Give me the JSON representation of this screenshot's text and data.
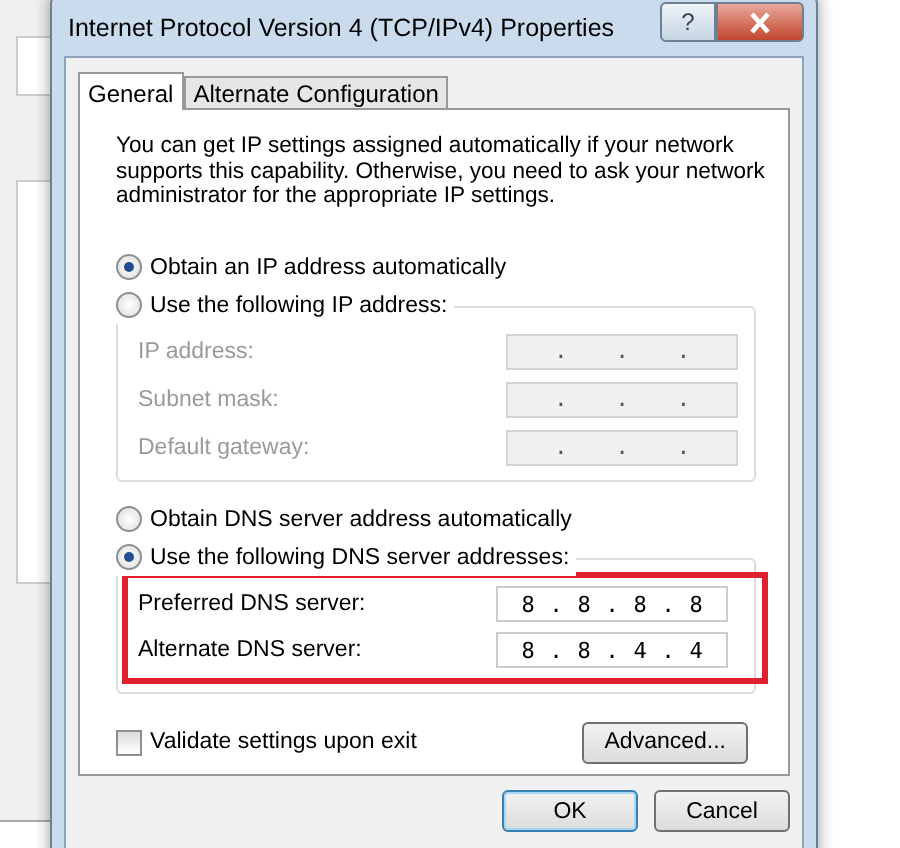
{
  "window": {
    "title": "Internet Protocol Version 4 (TCP/IPv4) Properties",
    "help": "?"
  },
  "tabs": [
    {
      "label": "General",
      "selected": true
    },
    {
      "label": "Alternate Configuration",
      "selected": false
    }
  ],
  "description": "You can get IP settings assigned automatically if your network supports this capability. Otherwise, you need to ask your network administrator for the appropriate IP settings.",
  "ip_options": [
    {
      "label": "Obtain an IP address automatically",
      "selected": true
    },
    {
      "label": "Use the following IP address:",
      "selected": false
    }
  ],
  "ip_fields": [
    {
      "label": "IP address:",
      "parts": [
        ".",
        ".",
        "."
      ],
      "disabled": true
    },
    {
      "label": "Subnet mask:",
      "parts": [
        ".",
        ".",
        "."
      ],
      "disabled": true
    },
    {
      "label": "Default gateway:",
      "parts": [
        ".",
        ".",
        "."
      ],
      "disabled": true
    }
  ],
  "dns_options": [
    {
      "label": "Obtain DNS server address automatically",
      "selected": false
    },
    {
      "label": "Use the following DNS server addresses:",
      "selected": true
    }
  ],
  "dns_fields": [
    {
      "label": "Preferred DNS server:",
      "parts": [
        "8",
        ".",
        "8",
        ".",
        "8",
        ".",
        "8"
      ],
      "disabled": false
    },
    {
      "label": "Alternate DNS server:",
      "parts": [
        "8",
        ".",
        "8",
        ".",
        "4",
        ".",
        "4"
      ],
      "disabled": false
    }
  ],
  "validate": {
    "label": "Validate settings upon exit",
    "checked": false
  },
  "advanced_button": "Advanced...",
  "buttons": [
    {
      "label": "OK",
      "default": true
    },
    {
      "label": "Cancel",
      "default": false
    }
  ]
}
